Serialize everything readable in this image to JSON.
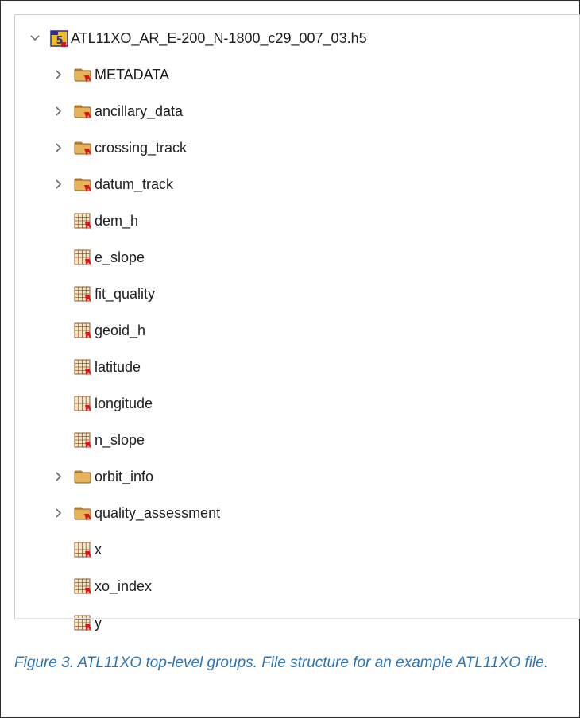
{
  "tree": {
    "root": {
      "label": "ATL11XO_AR_E-200_N-1800_c29_007_03.h5",
      "icon": "hdf5-file-icon",
      "expanded": true
    },
    "items": [
      {
        "label": "METADATA",
        "kind": "group",
        "expandable": true,
        "icon": "group-folder-icon"
      },
      {
        "label": "ancillary_data",
        "kind": "group",
        "expandable": true,
        "icon": "group-folder-icon"
      },
      {
        "label": "crossing_track",
        "kind": "group",
        "expandable": true,
        "icon": "group-folder-icon"
      },
      {
        "label": "datum_track",
        "kind": "group",
        "expandable": true,
        "icon": "group-folder-icon"
      },
      {
        "label": "dem_h",
        "kind": "dataset",
        "expandable": false,
        "icon": "dataset-grid-icon"
      },
      {
        "label": "e_slope",
        "kind": "dataset",
        "expandable": false,
        "icon": "dataset-grid-icon"
      },
      {
        "label": "fit_quality",
        "kind": "dataset",
        "expandable": false,
        "icon": "dataset-grid-icon"
      },
      {
        "label": "geoid_h",
        "kind": "dataset",
        "expandable": false,
        "icon": "dataset-grid-icon"
      },
      {
        "label": "latitude",
        "kind": "dataset",
        "expandable": false,
        "icon": "dataset-grid-icon"
      },
      {
        "label": "longitude",
        "kind": "dataset",
        "expandable": false,
        "icon": "dataset-grid-icon"
      },
      {
        "label": "n_slope",
        "kind": "dataset",
        "expandable": false,
        "icon": "dataset-grid-icon"
      },
      {
        "label": "orbit_info",
        "kind": "group",
        "expandable": true,
        "icon": "folder-icon"
      },
      {
        "label": "quality_assessment",
        "kind": "group",
        "expandable": true,
        "icon": "group-folder-icon"
      },
      {
        "label": "x",
        "kind": "dataset",
        "expandable": false,
        "icon": "dataset-grid-icon"
      },
      {
        "label": "xo_index",
        "kind": "dataset",
        "expandable": false,
        "icon": "dataset-grid-icon"
      },
      {
        "label": "y",
        "kind": "dataset",
        "expandable": false,
        "icon": "dataset-grid-icon"
      }
    ]
  },
  "caption": "Figure 3.  ATL11XO top-level groups.  File structure for an example ATL11XO file.",
  "colors": {
    "caption": "#2e75b6",
    "folder": "#e8b25a",
    "dataset_grid": "#8a5a2b",
    "attr_marker": "#e0121a",
    "hdf_icon": "#f0c020"
  }
}
